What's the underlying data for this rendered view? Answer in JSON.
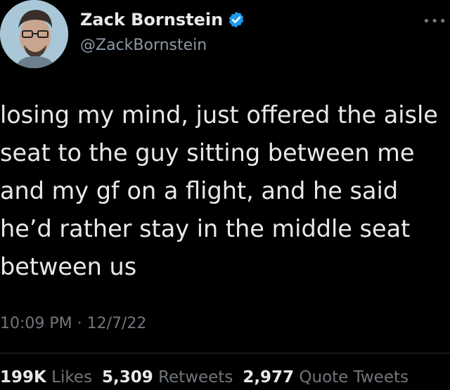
{
  "author": {
    "display_name": "Zack Bornstein",
    "handle": "@ZackBornstein",
    "verified": true,
    "avatar_icon": "user-avatar",
    "verified_color": "#1d9bf0"
  },
  "more_icon": "more-options-icon",
  "tweet": {
    "lines": [
      "losing my mind, just offered the aisle",
      "seat to the guy sitting between me",
      "and my gf on a flight, and he said",
      "he’d rather stay in the middle seat",
      "between us"
    ],
    "timestamp": "10:09 PM · 12/7/22"
  },
  "stats": {
    "likes": {
      "count": "199K",
      "label": "Likes"
    },
    "retweets": {
      "count": "5,309",
      "label": "Retweets"
    },
    "quotes": {
      "count": "2,977",
      "label": "Quote Tweets"
    }
  }
}
